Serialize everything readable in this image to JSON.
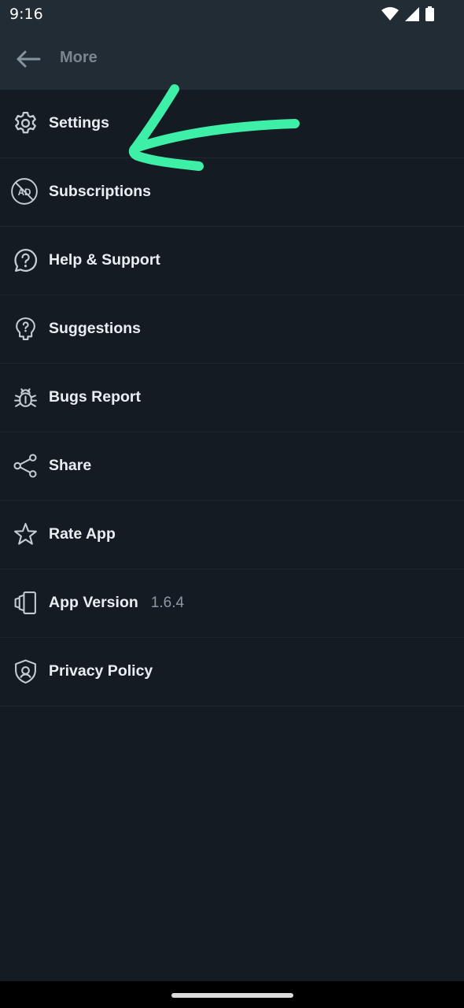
{
  "status_bar": {
    "time": "9:16"
  },
  "app_bar": {
    "title": "More"
  },
  "menu": [
    {
      "id": "settings",
      "label": "Settings",
      "icon": "gear-icon"
    },
    {
      "id": "subscriptions",
      "label": "Subscriptions",
      "icon": "no-ads-icon"
    },
    {
      "id": "help",
      "label": "Help & Support",
      "icon": "help-icon"
    },
    {
      "id": "suggestions",
      "label": "Suggestions",
      "icon": "suggestion-icon"
    },
    {
      "id": "bugs",
      "label": "Bugs Report",
      "icon": "bug-icon"
    },
    {
      "id": "share",
      "label": "Share",
      "icon": "share-icon"
    },
    {
      "id": "rate",
      "label": "Rate App",
      "icon": "star-icon"
    },
    {
      "id": "version",
      "label": "App Version",
      "value": "1.6.4",
      "icon": "app-version-icon"
    },
    {
      "id": "privacy",
      "label": "Privacy Policy",
      "icon": "shield-icon"
    }
  ],
  "colors": {
    "background": "#151b22",
    "app_bar": "#222c35",
    "annotation_arrow": "#3ef0a7"
  }
}
